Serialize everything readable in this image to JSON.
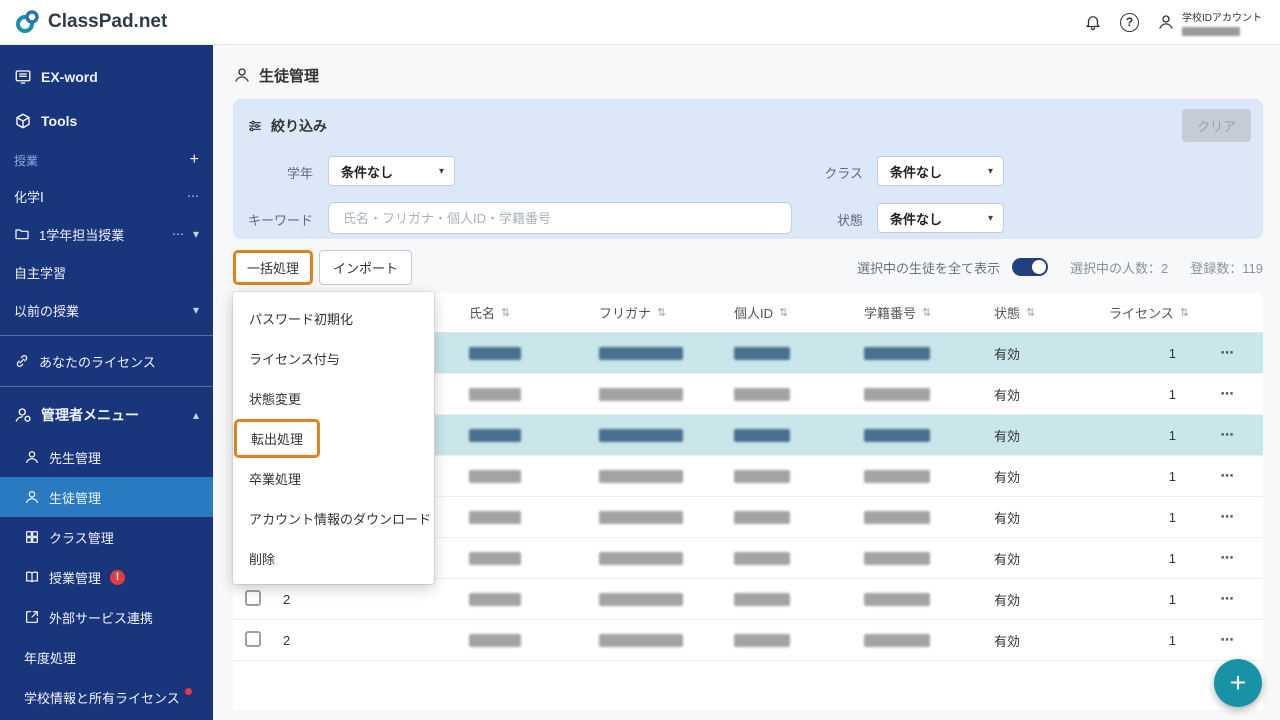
{
  "glyphs": {
    "plus": "+",
    "ellipsis": "⋯",
    "chevron_down": "▾",
    "chevron_up": "▴",
    "caret": "▾",
    "sort": "⇅",
    "dots": "⋯",
    "fab_plus": "+",
    "question": "?"
  },
  "header": {
    "logo_text": "ClassPad.net",
    "account_label": "学校IDアカウント"
  },
  "sidebar": {
    "exword_label": "EX-word",
    "tools_label": "Tools",
    "class_section_label": "授業",
    "items": [
      {
        "label": "化学Ⅰ"
      },
      {
        "label": "1学年担当授業"
      },
      {
        "label": "自主学習"
      },
      {
        "label": "以前の授業"
      }
    ],
    "license_label": "あなたのライセンス",
    "admin_label": "管理者メニュー",
    "admin_items": [
      {
        "label": "先生管理"
      },
      {
        "label": "生徒管理"
      },
      {
        "label": "クラス管理"
      },
      {
        "label": "授業管理",
        "badge": "!"
      },
      {
        "label": "外部サービス連携"
      },
      {
        "label": "年度処理"
      },
      {
        "label": "学校情報と所有ライセンス"
      }
    ]
  },
  "page": {
    "title": "生徒管理"
  },
  "filter": {
    "title": "絞り込み",
    "clear_label": "クリア",
    "grade_label": "学年",
    "class_label": "クラス",
    "keyword_label": "キーワード",
    "status_label": "状態",
    "grade_value": "条件なし",
    "class_value": "条件なし",
    "status_value": "条件なし",
    "keyword_placeholder": "氏名・フリガナ・個人ID・学籍番号"
  },
  "toolbar": {
    "bulk_label": "一括処理",
    "import_label": "インポート",
    "show_selected_label": "選択中の生徒を全て表示",
    "selected_count": "選択中の人数：2",
    "registered_count": "登録数：119"
  },
  "bulk_menu": {
    "items": [
      "パスワード初期化",
      "ライセンス付与",
      "状態変更",
      "転出処理",
      "卒業処理",
      "アカウント情報のダウンロード",
      "削除"
    ],
    "highlighted": "転出処理"
  },
  "table": {
    "headers": [
      "氏名",
      "フリガナ",
      "個人ID",
      "学籍番号",
      "状態",
      "ライセンス"
    ],
    "rows": [
      {
        "grade": "",
        "status": "有効",
        "license": "1",
        "selected": true
      },
      {
        "grade": "",
        "status": "有効",
        "license": "1",
        "selected": false
      },
      {
        "grade": "",
        "status": "有効",
        "license": "1",
        "selected": true
      },
      {
        "grade": "",
        "status": "有効",
        "license": "1",
        "selected": false
      },
      {
        "grade": "",
        "status": "有効",
        "license": "1",
        "selected": false
      },
      {
        "grade": "",
        "status": "有効",
        "license": "1",
        "selected": false
      },
      {
        "grade": "2",
        "status": "有効",
        "license": "1",
        "selected": false
      },
      {
        "grade": "2",
        "status": "有効",
        "license": "1",
        "selected": false
      }
    ]
  }
}
